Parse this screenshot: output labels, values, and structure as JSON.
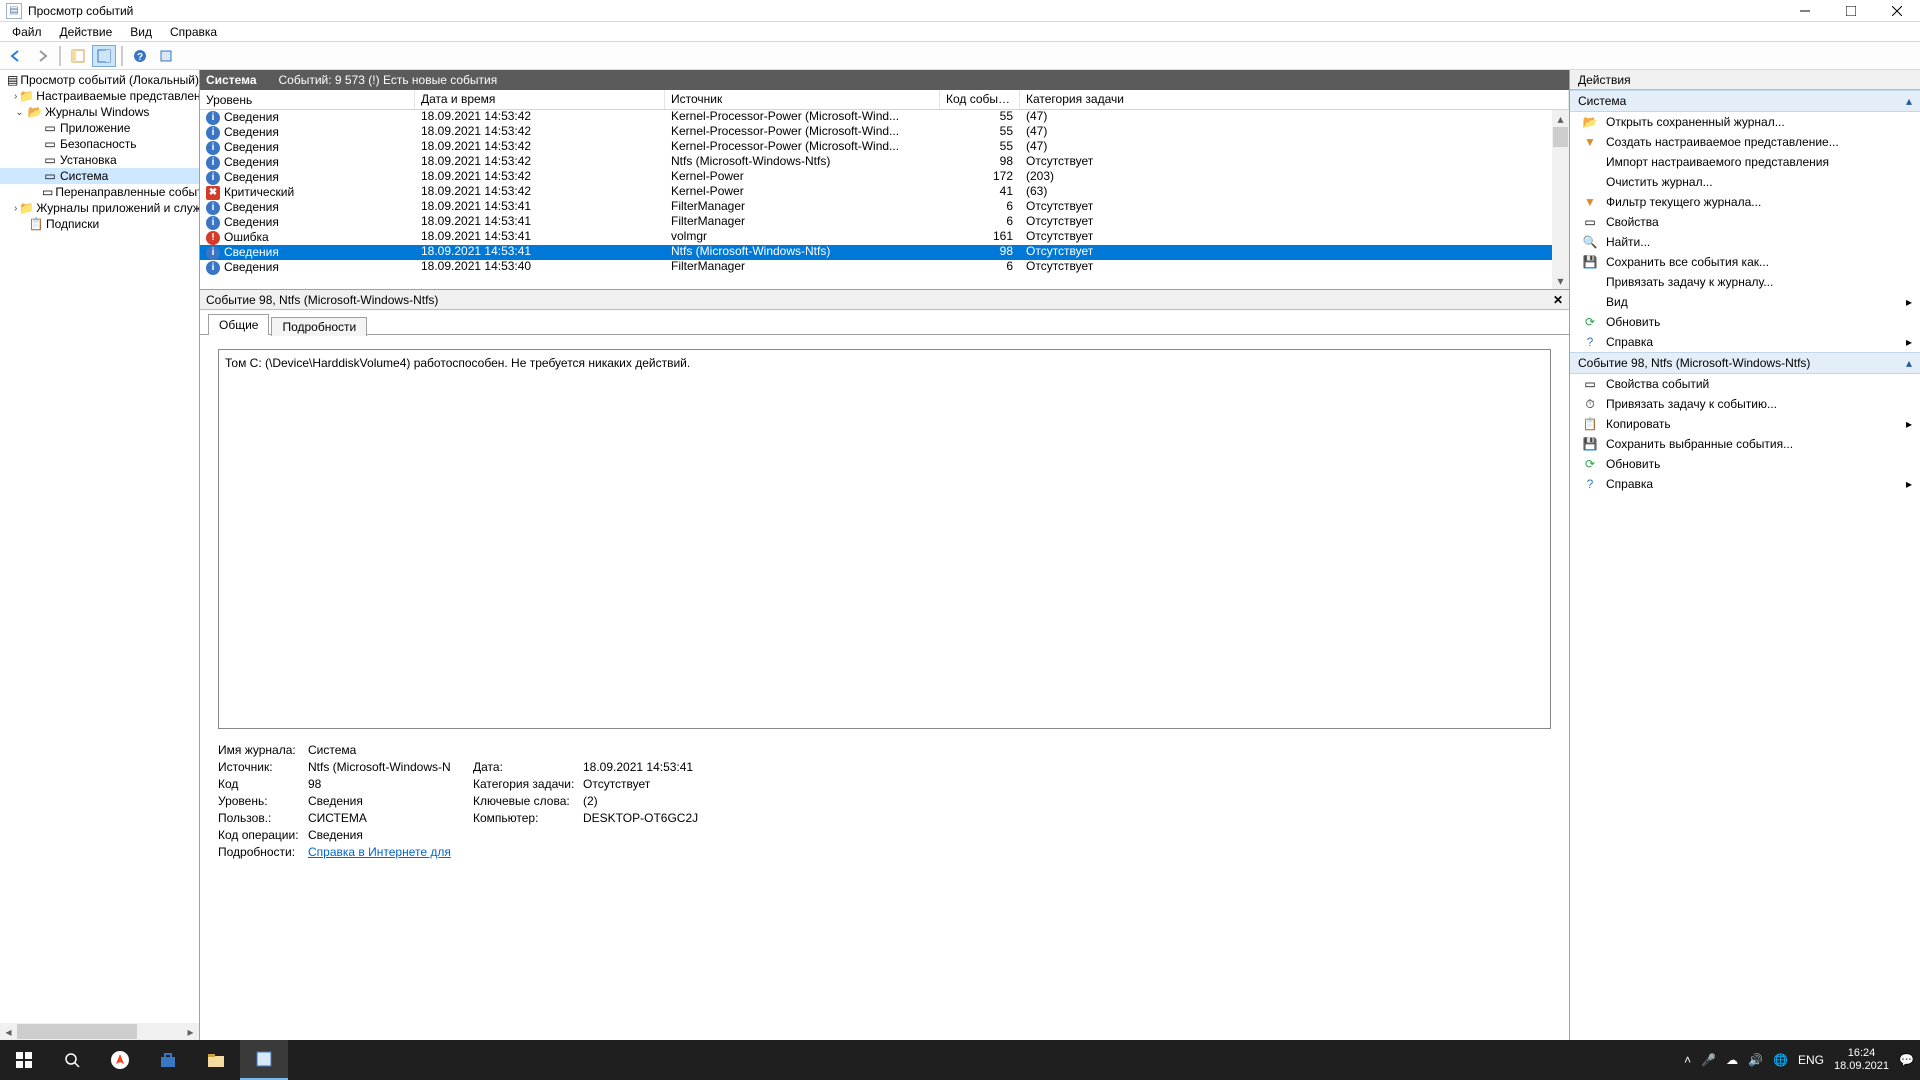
{
  "window": {
    "title": "Просмотр событий"
  },
  "menu": {
    "file": "Файл",
    "action": "Действие",
    "view": "Вид",
    "help": "Справка"
  },
  "tree": {
    "root": "Просмотр событий (Локальный)",
    "custom": "Настраиваемые представления",
    "winlogs": "Журналы Windows",
    "app": "Приложение",
    "sec": "Безопасность",
    "setup": "Установка",
    "system": "Система",
    "fwd": "Перенаправленные события",
    "appsvc": "Журналы приложений и служб",
    "subs": "Подписки"
  },
  "center": {
    "name": "Система",
    "count_label": "Событий: 9 573 (!) Есть новые события",
    "columns": {
      "level": "Уровень",
      "date": "Дата и время",
      "src": "Источник",
      "code": "Код события",
      "cat": "Категория задачи"
    },
    "rows": [
      {
        "lvl": "Сведения",
        "dt": "18.09.2021 14:53:42",
        "src": "Kernel-Processor-Power (Microsoft-Wind...",
        "code": "55",
        "cat": "(47)",
        "ic": "info"
      },
      {
        "lvl": "Сведения",
        "dt": "18.09.2021 14:53:42",
        "src": "Kernel-Processor-Power (Microsoft-Wind...",
        "code": "55",
        "cat": "(47)",
        "ic": "info"
      },
      {
        "lvl": "Сведения",
        "dt": "18.09.2021 14:53:42",
        "src": "Kernel-Processor-Power (Microsoft-Wind...",
        "code": "55",
        "cat": "(47)",
        "ic": "info"
      },
      {
        "lvl": "Сведения",
        "dt": "18.09.2021 14:53:42",
        "src": "Ntfs (Microsoft-Windows-Ntfs)",
        "code": "98",
        "cat": "Отсутствует",
        "ic": "info"
      },
      {
        "lvl": "Сведения",
        "dt": "18.09.2021 14:53:42",
        "src": "Kernel-Power",
        "code": "172",
        "cat": "(203)",
        "ic": "info"
      },
      {
        "lvl": "Критический",
        "dt": "18.09.2021 14:53:42",
        "src": "Kernel-Power",
        "code": "41",
        "cat": "(63)",
        "ic": "crit"
      },
      {
        "lvl": "Сведения",
        "dt": "18.09.2021 14:53:41",
        "src": "FilterManager",
        "code": "6",
        "cat": "Отсутствует",
        "ic": "info"
      },
      {
        "lvl": "Сведения",
        "dt": "18.09.2021 14:53:41",
        "src": "FilterManager",
        "code": "6",
        "cat": "Отсутствует",
        "ic": "info"
      },
      {
        "lvl": "Ошибка",
        "dt": "18.09.2021 14:53:41",
        "src": "volmgr",
        "code": "161",
        "cat": "Отсутствует",
        "ic": "err"
      },
      {
        "lvl": "Сведения",
        "dt": "18.09.2021 14:53:41",
        "src": "Ntfs (Microsoft-Windows-Ntfs)",
        "code": "98",
        "cat": "Отсутствует",
        "ic": "info",
        "sel": true
      },
      {
        "lvl": "Сведения",
        "dt": "18.09.2021 14:53:40",
        "src": "FilterManager",
        "code": "6",
        "cat": "Отсутствует",
        "ic": "info"
      }
    ]
  },
  "detail": {
    "title": "Событие 98, Ntfs (Microsoft-Windows-Ntfs)",
    "tab_general": "Общие",
    "tab_details": "Подробности",
    "message": "Том C: (\\Device\\HarddiskVolume4) работоспособен.  Не требуется никаких действий.",
    "labels": {
      "logname": "Имя журнала:",
      "source": "Источник:",
      "date": "Дата:",
      "eventid": "Код",
      "category": "Категория задачи:",
      "level": "Уровень:",
      "keywords": "Ключевые слова:",
      "user": "Пользов.:",
      "computer": "Компьютер:",
      "opcode": "Код операции:",
      "more": "Подробности:"
    },
    "values": {
      "logname": "Система",
      "source": "Ntfs (Microsoft-Windows-N",
      "date": "18.09.2021 14:53:41",
      "eventid": "98",
      "category": "Отсутствует",
      "level": "Сведения",
      "keywords": "(2)",
      "user": "СИСТЕМА",
      "computer": "DESKTOP-OT6GC2J",
      "opcode": "Сведения",
      "more_link": "Справка в Интернете для "
    }
  },
  "actions": {
    "panel_title": "Действия",
    "section_sys": "Система",
    "section_evt": "Событие 98, Ntfs (Microsoft-Windows-Ntfs)",
    "sys": {
      "open_saved": "Открыть сохраненный журнал...",
      "create_custom": "Создать настраиваемое представление...",
      "import_custom": "Импорт настраиваемого представления",
      "clear": "Очистить журнал...",
      "filter": "Фильтр текущего журнала...",
      "props": "Свойства",
      "find": "Найти...",
      "save_all": "Сохранить все события как...",
      "attach": "Привязать задачу к журналу...",
      "view": "Вид",
      "refresh": "Обновить",
      "help": "Справка"
    },
    "evt": {
      "props": "Свойства событий",
      "attach": "Привязать задачу к событию...",
      "copy": "Копировать",
      "save_sel": "Сохранить выбранные события...",
      "refresh": "Обновить",
      "help": "Справка"
    }
  },
  "taskbar": {
    "lang": "ENG",
    "time": "16:24",
    "date": "18.09.2021"
  }
}
